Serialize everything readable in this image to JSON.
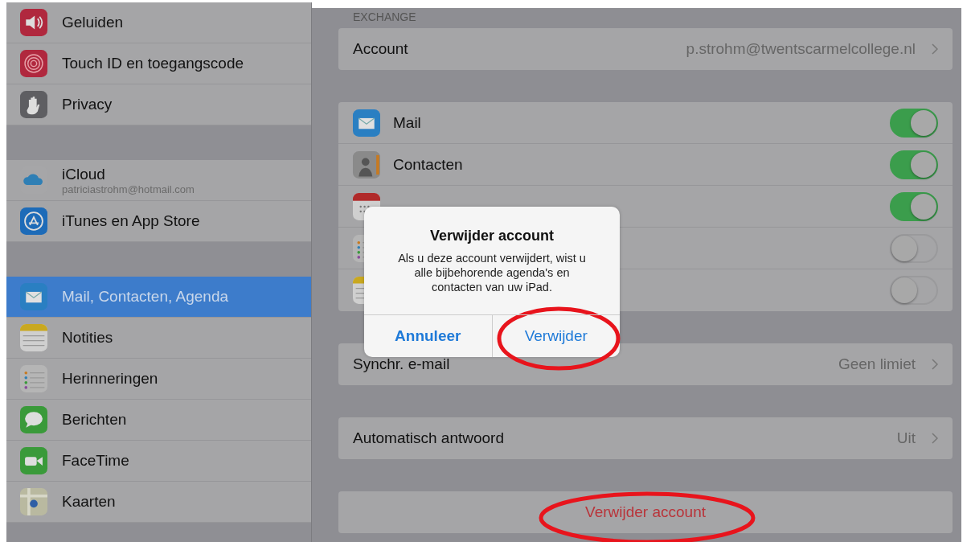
{
  "sidebar": {
    "groups": [
      {
        "items": [
          {
            "label": "Geluiden",
            "kind": "speaker",
            "selected": false
          },
          {
            "label": "Touch ID en toegangscode",
            "kind": "fingerprint",
            "selected": false
          },
          {
            "label": "Privacy",
            "kind": "hand",
            "selected": false
          }
        ]
      },
      {
        "items": [
          {
            "label": "iCloud",
            "sublabel": "patriciastrohm@hotmail.com",
            "kind": "cloud",
            "selected": false
          },
          {
            "label": "iTunes en App Store",
            "kind": "appstore",
            "selected": false
          }
        ]
      },
      {
        "items": [
          {
            "label": "Mail, Contacten, Agenda",
            "kind": "mail",
            "selected": true
          },
          {
            "label": "Notities",
            "kind": "notes",
            "selected": false
          },
          {
            "label": "Herinneringen",
            "kind": "list",
            "selected": false
          },
          {
            "label": "Berichten",
            "kind": "bubble",
            "selected": false
          },
          {
            "label": "FaceTime",
            "kind": "video",
            "selected": false
          },
          {
            "label": "Kaarten",
            "kind": "map",
            "selected": false
          }
        ]
      }
    ]
  },
  "detail": {
    "section_header": "EXCHANGE",
    "account": {
      "label": "Account",
      "value": "p.strohm@twentscarmelcollege.nl"
    },
    "services": [
      {
        "label": "Mail",
        "kind": "mail",
        "on": true
      },
      {
        "label": "Contacten",
        "kind": "contacts",
        "on": true
      },
      {
        "kind": "calendar",
        "on": true
      },
      {
        "kind": "list",
        "on": false
      },
      {
        "kind": "notes",
        "on": false
      }
    ],
    "sync": {
      "label": "Synchr. e-mail",
      "value": "Geen limiet"
    },
    "auto_reply": {
      "label": "Automatisch antwoord",
      "value": "Uit"
    },
    "delete_button": {
      "label": "Verwijder account",
      "highlighted": true
    }
  },
  "dialog": {
    "title": "Verwijder account",
    "message": "Als u deze account verwijdert, wist u alle bijbehorende agenda's en contacten van uw iPad.",
    "buttons": [
      {
        "label": "Annuleer",
        "bold": true,
        "highlighted": false
      },
      {
        "label": "Verwijder",
        "bold": false,
        "highlighted": true
      }
    ]
  }
}
